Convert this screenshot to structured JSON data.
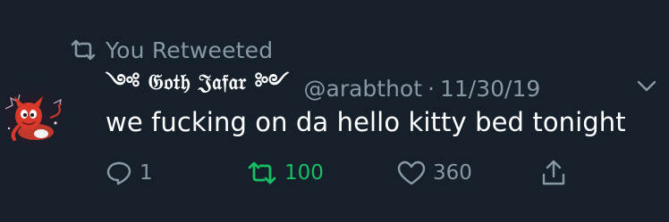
{
  "social_context": {
    "text": "You Retweeted"
  },
  "author": {
    "display_name": "𝔊𝔬𝔱𝔥 𝔍𝔞𝔣𝔞𝔯",
    "handle": "@arabthot",
    "separator": "·",
    "date": "11/30/19"
  },
  "tweet": {
    "text": "we fucking on da hello kitty bed tonight"
  },
  "actions": {
    "reply_count": "1",
    "retweet_count": "100",
    "like_count": "360"
  },
  "colors": {
    "background": "#15202b",
    "secondary_text": "#8899a6",
    "retweet_active": "#17bf63"
  }
}
